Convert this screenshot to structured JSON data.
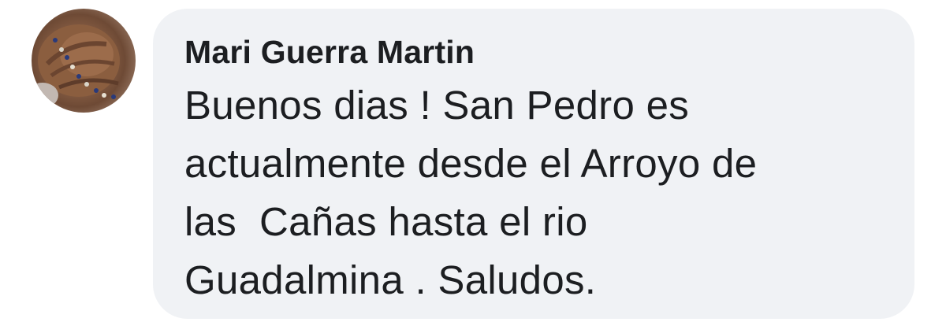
{
  "comment": {
    "author": "Mari Guerra Martin",
    "avatar_icon": "profile-photo-avatar",
    "text_lines": [
      "Buenos dias ! San Pedro es",
      "actualmente desde el Arroyo de",
      "las  Cañas hasta el rio",
      "Guadalmina . Saludos."
    ]
  },
  "colors": {
    "bubble_background": "#f0f2f5",
    "text": "#1c1e21"
  }
}
